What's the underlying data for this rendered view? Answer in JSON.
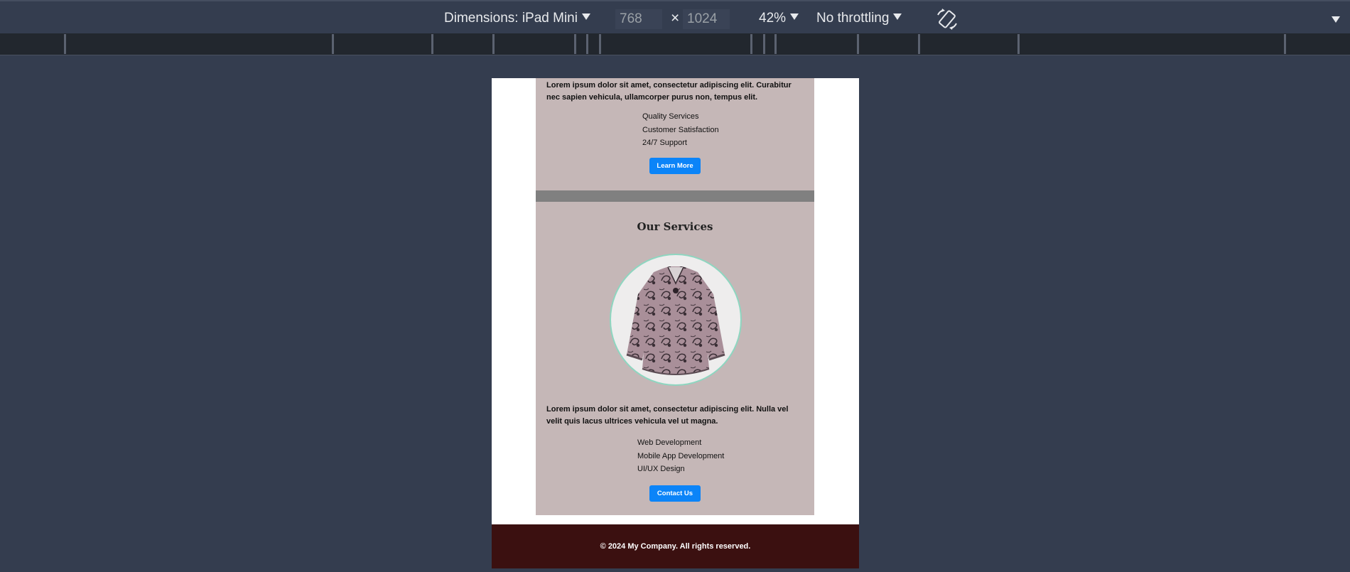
{
  "devtools": {
    "dimensions_label": "Dimensions: iPad Mini",
    "width": "768",
    "times": "×",
    "height": "1024",
    "zoom": "42%",
    "throttling": "No throttling"
  },
  "email": {
    "intro": {
      "paragraph": "Lorem ipsum dolor sit amet, consectetur adipiscing elit. Curabitur nec sapien vehicula, ullamcorper purus non, tempus elit.",
      "features": [
        "Quality Services",
        "Customer Satisfaction",
        "24/7 Support"
      ],
      "button_label": "Learn More"
    },
    "services": {
      "title": "Our Services",
      "paragraph": "Lorem ipsum dolor sit amet, consectetur adipiscing elit. Nulla vel velit quis lacus ultrices vehicula vel ut magna.",
      "items": [
        "Web Development",
        "Mobile App Development",
        "UI/UX Design"
      ],
      "button_label": "Contact Us"
    },
    "footer": {
      "text": "© 2024 My Company. All rights reserved."
    }
  },
  "colors": {
    "page_bg": "#343d4f",
    "card_bg": "#c5b7b7",
    "divider": "#808080",
    "button": "#0b84f8",
    "footer_bg": "#3b1010"
  },
  "icons": {
    "rotate": "rotate-device-icon",
    "dropdown": "chevron-down-icon"
  }
}
